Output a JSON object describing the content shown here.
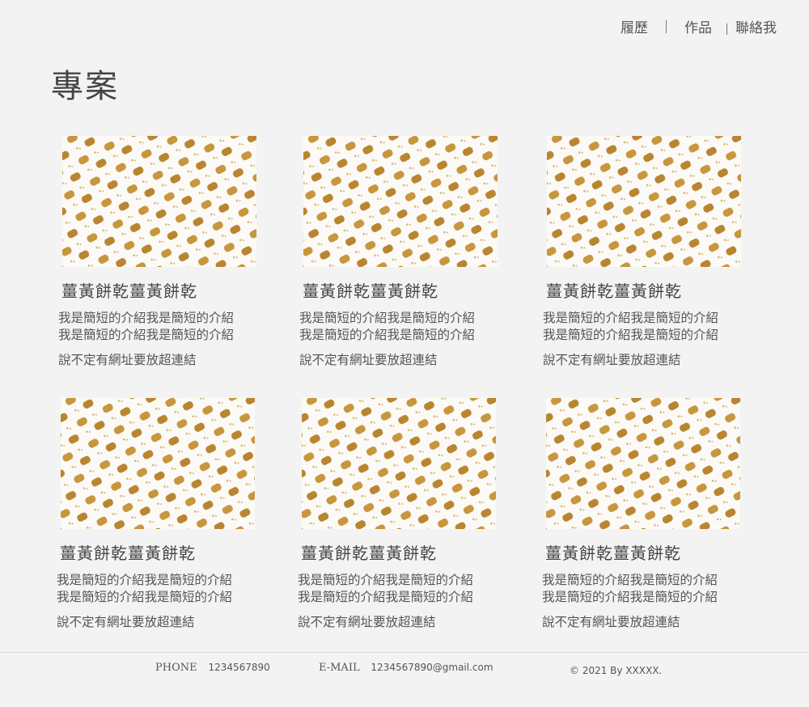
{
  "nav": {
    "resume": "履歷",
    "works": "作品",
    "contact": "聯絡我"
  },
  "page_title": "專案",
  "projects": [
    {
      "title": "薑黃餅乾薑黃餅乾",
      "desc_line1": "我是簡短的介紹我是簡短的介紹",
      "desc_line2": "我是簡短的介紹我是簡短的介紹",
      "link": "說不定有網址要放超連結"
    },
    {
      "title": "薑黃餅乾薑黃餅乾",
      "desc_line1": "我是簡短的介紹我是簡短的介紹",
      "desc_line2": "我是簡短的介紹我是簡短的介紹",
      "link": "說不定有網址要放超連結"
    },
    {
      "title": "薑黃餅乾薑黃餅乾",
      "desc_line1": "我是簡短的介紹我是簡短的介紹",
      "desc_line2": "我是簡短的介紹我是簡短的介紹",
      "link": "說不定有網址要放超連結"
    },
    {
      "title": "薑黃餅乾薑黃餅乾",
      "desc_line1": "我是簡短的介紹我是簡短的介紹",
      "desc_line2": "我是簡短的介紹我是簡短的介紹",
      "link": "說不定有網址要放超連結"
    },
    {
      "title": "薑黃餅乾薑黃餅乾",
      "desc_line1": "我是簡短的介紹我是簡短的介紹",
      "desc_line2": "我是簡短的介紹我是簡短的介紹",
      "link": "說不定有網址要放超連結"
    },
    {
      "title": "薑黃餅乾薑黃餅乾",
      "desc_line1": "我是簡短的介紹我是簡短的介紹",
      "desc_line2": "我是簡短的介紹我是簡短的介紹",
      "link": "說不定有網址要放超連結"
    }
  ],
  "footer": {
    "phone_label": "PHONE",
    "phone": "1234567890",
    "email_label": "E-MAIL",
    "email": "1234567890@gmail.com",
    "copyright": "© 2021 By XXXXX."
  },
  "colors": {
    "background": "#f3f3f3",
    "cookie": "#c8963e",
    "cookie_dark": "#a87424",
    "pattern_bg": "#fbfaf6"
  }
}
